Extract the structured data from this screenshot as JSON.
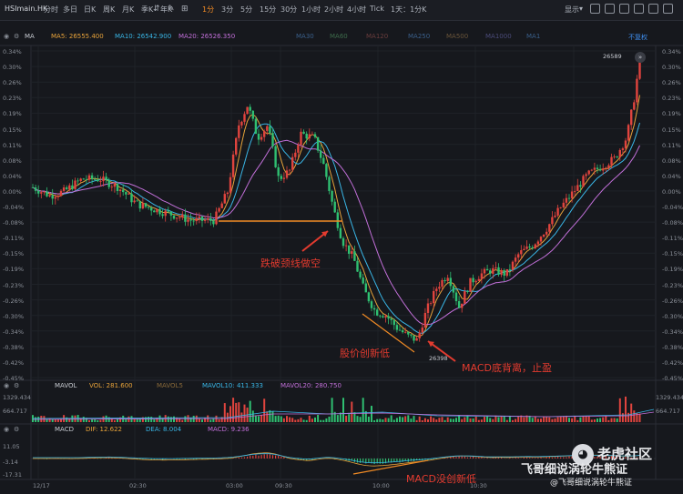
{
  "toolbar": {
    "symbol": "HSImain.HK",
    "timeframes": [
      "分时",
      "多日",
      "日K",
      "周K",
      "月K",
      "季K",
      "年K",
      "1分",
      "3分",
      "5分",
      "15分",
      "30分",
      "1小时",
      "2小时",
      "4小时",
      "Tick",
      "1天：1分K"
    ],
    "active_timeframe": "1分",
    "display_label": "显示"
  },
  "main_legend": {
    "indicator": "MA",
    "ma5": "MA5: 26555.400",
    "ma10": "MA10: 26542.900",
    "ma20": "MA20: 26526.350",
    "extra": [
      "MA30",
      "MA60",
      "MA120",
      "MA250",
      "MA500",
      "MA1000",
      "MA1"
    ],
    "adjust": "不复权"
  },
  "price_axis": [
    "0.34%",
    "0.30%",
    "0.26%",
    "0.23%",
    "0.19%",
    "0.15%",
    "0.11%",
    "0.08%",
    "0.04%",
    "0.00%",
    "-0.04%",
    "-0.08%",
    "-0.11%",
    "-0.15%",
    "-0.19%",
    "-0.23%",
    "-0.26%",
    "-0.30%",
    "-0.34%",
    "-0.38%",
    "-0.42%",
    "-0.45%"
  ],
  "high_label": "26589",
  "low_label": "26398",
  "annotations": {
    "break": "跌破颈线做空",
    "new_low": "股价创新低",
    "macd_div": "MACD底背离，止盈",
    "macd_no_low": "MACD没创新低"
  },
  "vol_legend": {
    "indicator": "MAVOL",
    "vol": "VOL: 281.600",
    "mavol5": "MAVOL5",
    "mavol10": "MAVOL10: 411.333",
    "mavol20": "MAVOL20: 280.750"
  },
  "vol_axis": [
    "1329.434",
    "664.717"
  ],
  "macd_legend": {
    "indicator": "MACD",
    "dif": "DIF: 12.622",
    "dea": "DEA: 8.004",
    "macd": "MACD: 9.236"
  },
  "macd_axis": [
    "11.05",
    "-3.14",
    "-17.31"
  ],
  "time_axis": [
    "12/17",
    "02:30",
    "03:00",
    "09:30",
    "10:00",
    "10:30"
  ],
  "watermark": {
    "brand": "老虎社区",
    "author": "飞哥细说涡轮牛熊证",
    "handle": "@飞哥细说涡轮牛熊证"
  },
  "colors": {
    "up": "#e0443e",
    "down": "#2fbf71",
    "ma5": "#e8a33a",
    "ma10": "#39b6e6",
    "ma20": "#c16fd8",
    "accent": "#f08a24",
    "annotation": "#e33b2f"
  }
}
